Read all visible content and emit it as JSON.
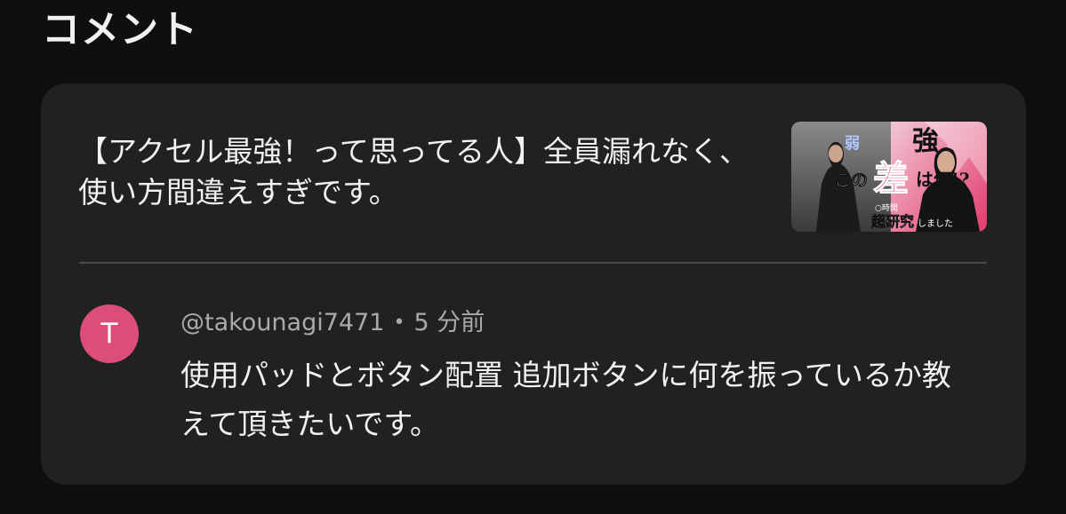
{
  "section": {
    "title": "コメント"
  },
  "video": {
    "title": "【アクセル最強！って思ってる人】全員漏れなく、使い方間違えすぎです。",
    "thumbnail": {
      "text_weak": "弱",
      "text_strong": "強",
      "text_main_pre": "この",
      "text_main_big": "差",
      "text_main_post": "は何!?",
      "text_small_a": "○時間",
      "text_small_b": "超研究",
      "text_small_c": "しました"
    }
  },
  "comment": {
    "avatar_letter": "T",
    "author": "@takounagi7471",
    "separator": "•",
    "time": "5 分前",
    "text": "使用パッドとボタン配置 追加ボタンに何を振っているか教えて頂きたいです。"
  },
  "colors": {
    "background": "#0f0f0f",
    "card": "#212121",
    "text_primary": "#f1f1f1",
    "text_secondary": "#aaaaaa",
    "avatar": "#dc4e7a",
    "divider": "#4a4a4a"
  }
}
